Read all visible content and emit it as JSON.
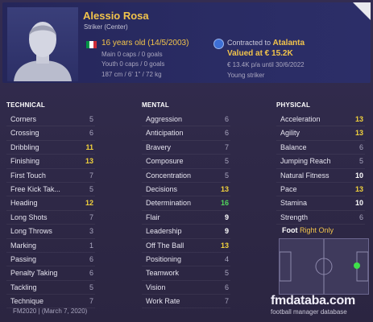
{
  "player": {
    "name": "Alessio Rosa",
    "position": "Striker (Center)",
    "age_line": "16 years old (14/5/2003)",
    "main_caps": "Main 0 caps / 0 goals",
    "youth_caps": "Youth 0 caps / 0 goals",
    "physique": "187 cm / 6' 1\" / 72 kg",
    "contracted_prefix": "Contracted to",
    "club": "Atalanta",
    "value": "Valued at € 15.2K",
    "wage": "€ 13.4K p/a until 30/6/2022",
    "role": "Young striker",
    "flag_colors": [
      "#009246",
      "#ffffff",
      "#ce2b37"
    ]
  },
  "technical": {
    "title": "TECHNICAL",
    "rows": [
      {
        "label": "Corners",
        "value": "5",
        "tier": "normal"
      },
      {
        "label": "Crossing",
        "value": "6",
        "tier": "normal"
      },
      {
        "label": "Dribbling",
        "value": "11",
        "tier": "hi"
      },
      {
        "label": "Finishing",
        "value": "13",
        "tier": "hi"
      },
      {
        "label": "First Touch",
        "value": "7",
        "tier": "normal"
      },
      {
        "label": "Free Kick Tak...",
        "value": "5",
        "tier": "normal"
      },
      {
        "label": "Heading",
        "value": "12",
        "tier": "hi"
      },
      {
        "label": "Long Shots",
        "value": "7",
        "tier": "normal"
      },
      {
        "label": "Long Throws",
        "value": "3",
        "tier": "normal"
      },
      {
        "label": "Marking",
        "value": "1",
        "tier": "normal"
      },
      {
        "label": "Passing",
        "value": "6",
        "tier": "normal"
      },
      {
        "label": "Penalty Taking",
        "value": "6",
        "tier": "normal"
      },
      {
        "label": "Tackling",
        "value": "5",
        "tier": "normal"
      },
      {
        "label": "Technique",
        "value": "7",
        "tier": "normal"
      }
    ]
  },
  "mental": {
    "title": "MENTAL",
    "rows": [
      {
        "label": "Aggression",
        "value": "6",
        "tier": "normal"
      },
      {
        "label": "Anticipation",
        "value": "6",
        "tier": "normal"
      },
      {
        "label": "Bravery",
        "value": "7",
        "tier": "normal"
      },
      {
        "label": "Composure",
        "value": "5",
        "tier": "normal"
      },
      {
        "label": "Concentration",
        "value": "5",
        "tier": "normal"
      },
      {
        "label": "Decisions",
        "value": "13",
        "tier": "hi"
      },
      {
        "label": "Determination",
        "value": "16",
        "tier": "top"
      },
      {
        "label": "Flair",
        "value": "9",
        "tier": "good"
      },
      {
        "label": "Leadership",
        "value": "9",
        "tier": "good"
      },
      {
        "label": "Off The Ball",
        "value": "13",
        "tier": "hi"
      },
      {
        "label": "Positioning",
        "value": "4",
        "tier": "normal"
      },
      {
        "label": "Teamwork",
        "value": "5",
        "tier": "normal"
      },
      {
        "label": "Vision",
        "value": "6",
        "tier": "normal"
      },
      {
        "label": "Work Rate",
        "value": "7",
        "tier": "normal"
      }
    ]
  },
  "physical": {
    "title": "PHYSICAL",
    "rows": [
      {
        "label": "Acceleration",
        "value": "13",
        "tier": "hi"
      },
      {
        "label": "Agility",
        "value": "13",
        "tier": "hi"
      },
      {
        "label": "Balance",
        "value": "6",
        "tier": "normal"
      },
      {
        "label": "Jumping Reach",
        "value": "5",
        "tier": "normal"
      },
      {
        "label": "Natural Fitness",
        "value": "10",
        "tier": "good"
      },
      {
        "label": "Pace",
        "value": "13",
        "tier": "hi"
      },
      {
        "label": "Stamina",
        "value": "10",
        "tier": "good"
      },
      {
        "label": "Strength",
        "value": "6",
        "tier": "normal"
      }
    ]
  },
  "foot": {
    "label": "Foot",
    "value": "Right Only"
  },
  "footer": {
    "edition": "FM2020 | (March 7, 2020)",
    "brand": "fmdataba.com",
    "brand_sub": "football manager database"
  },
  "colors": {
    "accent": "#f2c44b",
    "highlight": "#f2d23c",
    "top": "#52d65d",
    "position_marker": "#3fe04a"
  }
}
